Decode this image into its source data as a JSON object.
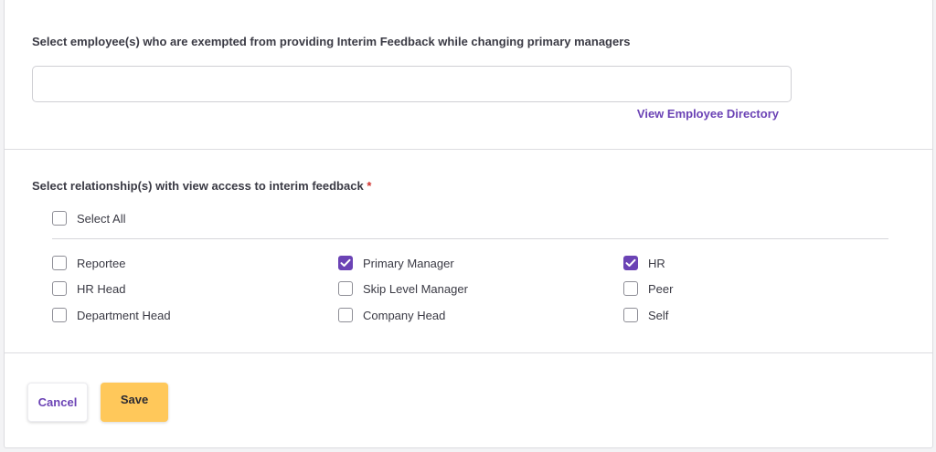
{
  "exemption": {
    "label": "Select employee(s) who are exempted from providing Interim Feedback while changing primary managers",
    "input_value": "",
    "directory_link": "View Employee Directory"
  },
  "relationships": {
    "label": "Select relationship(s) with view access to interim feedback",
    "required_marker": "*",
    "select_all": {
      "label": "Select All",
      "checked": false
    },
    "options": [
      {
        "label": "Reportee",
        "checked": false
      },
      {
        "label": "Primary Manager",
        "checked": true
      },
      {
        "label": "HR",
        "checked": true
      },
      {
        "label": "HR Head",
        "checked": false
      },
      {
        "label": "Skip Level Manager",
        "checked": false
      },
      {
        "label": "Peer",
        "checked": false
      },
      {
        "label": "Department Head",
        "checked": false
      },
      {
        "label": "Company Head",
        "checked": false
      },
      {
        "label": "Self",
        "checked": false
      }
    ]
  },
  "actions": {
    "cancel_label": "Cancel",
    "save_label": "Save"
  },
  "colors": {
    "accent": "#6b43b5",
    "save_button": "#ffc85a",
    "required": "#d0312d"
  }
}
